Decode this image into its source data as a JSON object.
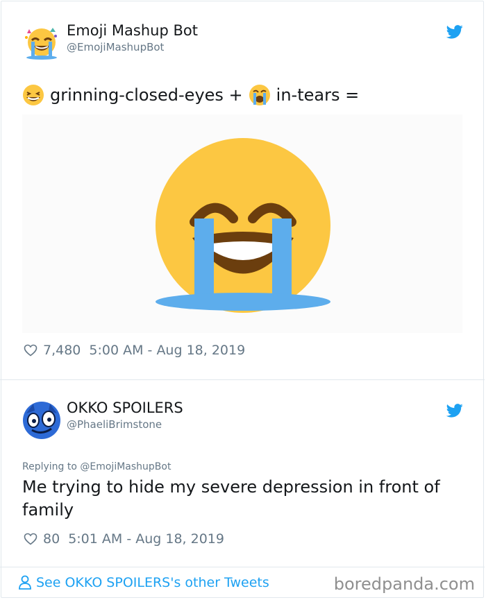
{
  "tweets": [
    {
      "name": "Emoji Mashup Bot",
      "handle": "@EmojiMashupBot",
      "text_part1": "grinning-closed-eyes +",
      "text_part2": "in-tears =",
      "likes": "7,480",
      "timestamp": "5:00 AM - Aug 18, 2019",
      "icons": [
        "avatar-crying-emoji",
        "grinning-closed-eyes-emoji",
        "in-tears-emoji",
        "heart-icon",
        "twitter-bird-icon"
      ]
    },
    {
      "name": "OKKO SPOILERS",
      "handle": "@PhaeliBrimstone",
      "replying_to": "Replying to @EmojiMashupBot",
      "text": "Me trying to hide my severe depression in front of family",
      "likes": "80",
      "timestamp": "5:01 AM - Aug 18, 2019",
      "icons": [
        "avatar-blue-creature",
        "heart-icon",
        "twitter-bird-icon"
      ]
    }
  ],
  "footer": {
    "see_more": "See OKKO SPOILERS's other Tweets",
    "watermark": "boredpanda.com"
  },
  "colors": {
    "twitter_blue": "#1da1f2",
    "meta_gray": "#657786",
    "emoji_yellow": "#fcc742",
    "tears_blue": "#5dadec",
    "mouth_brown": "#6b3e0e"
  }
}
